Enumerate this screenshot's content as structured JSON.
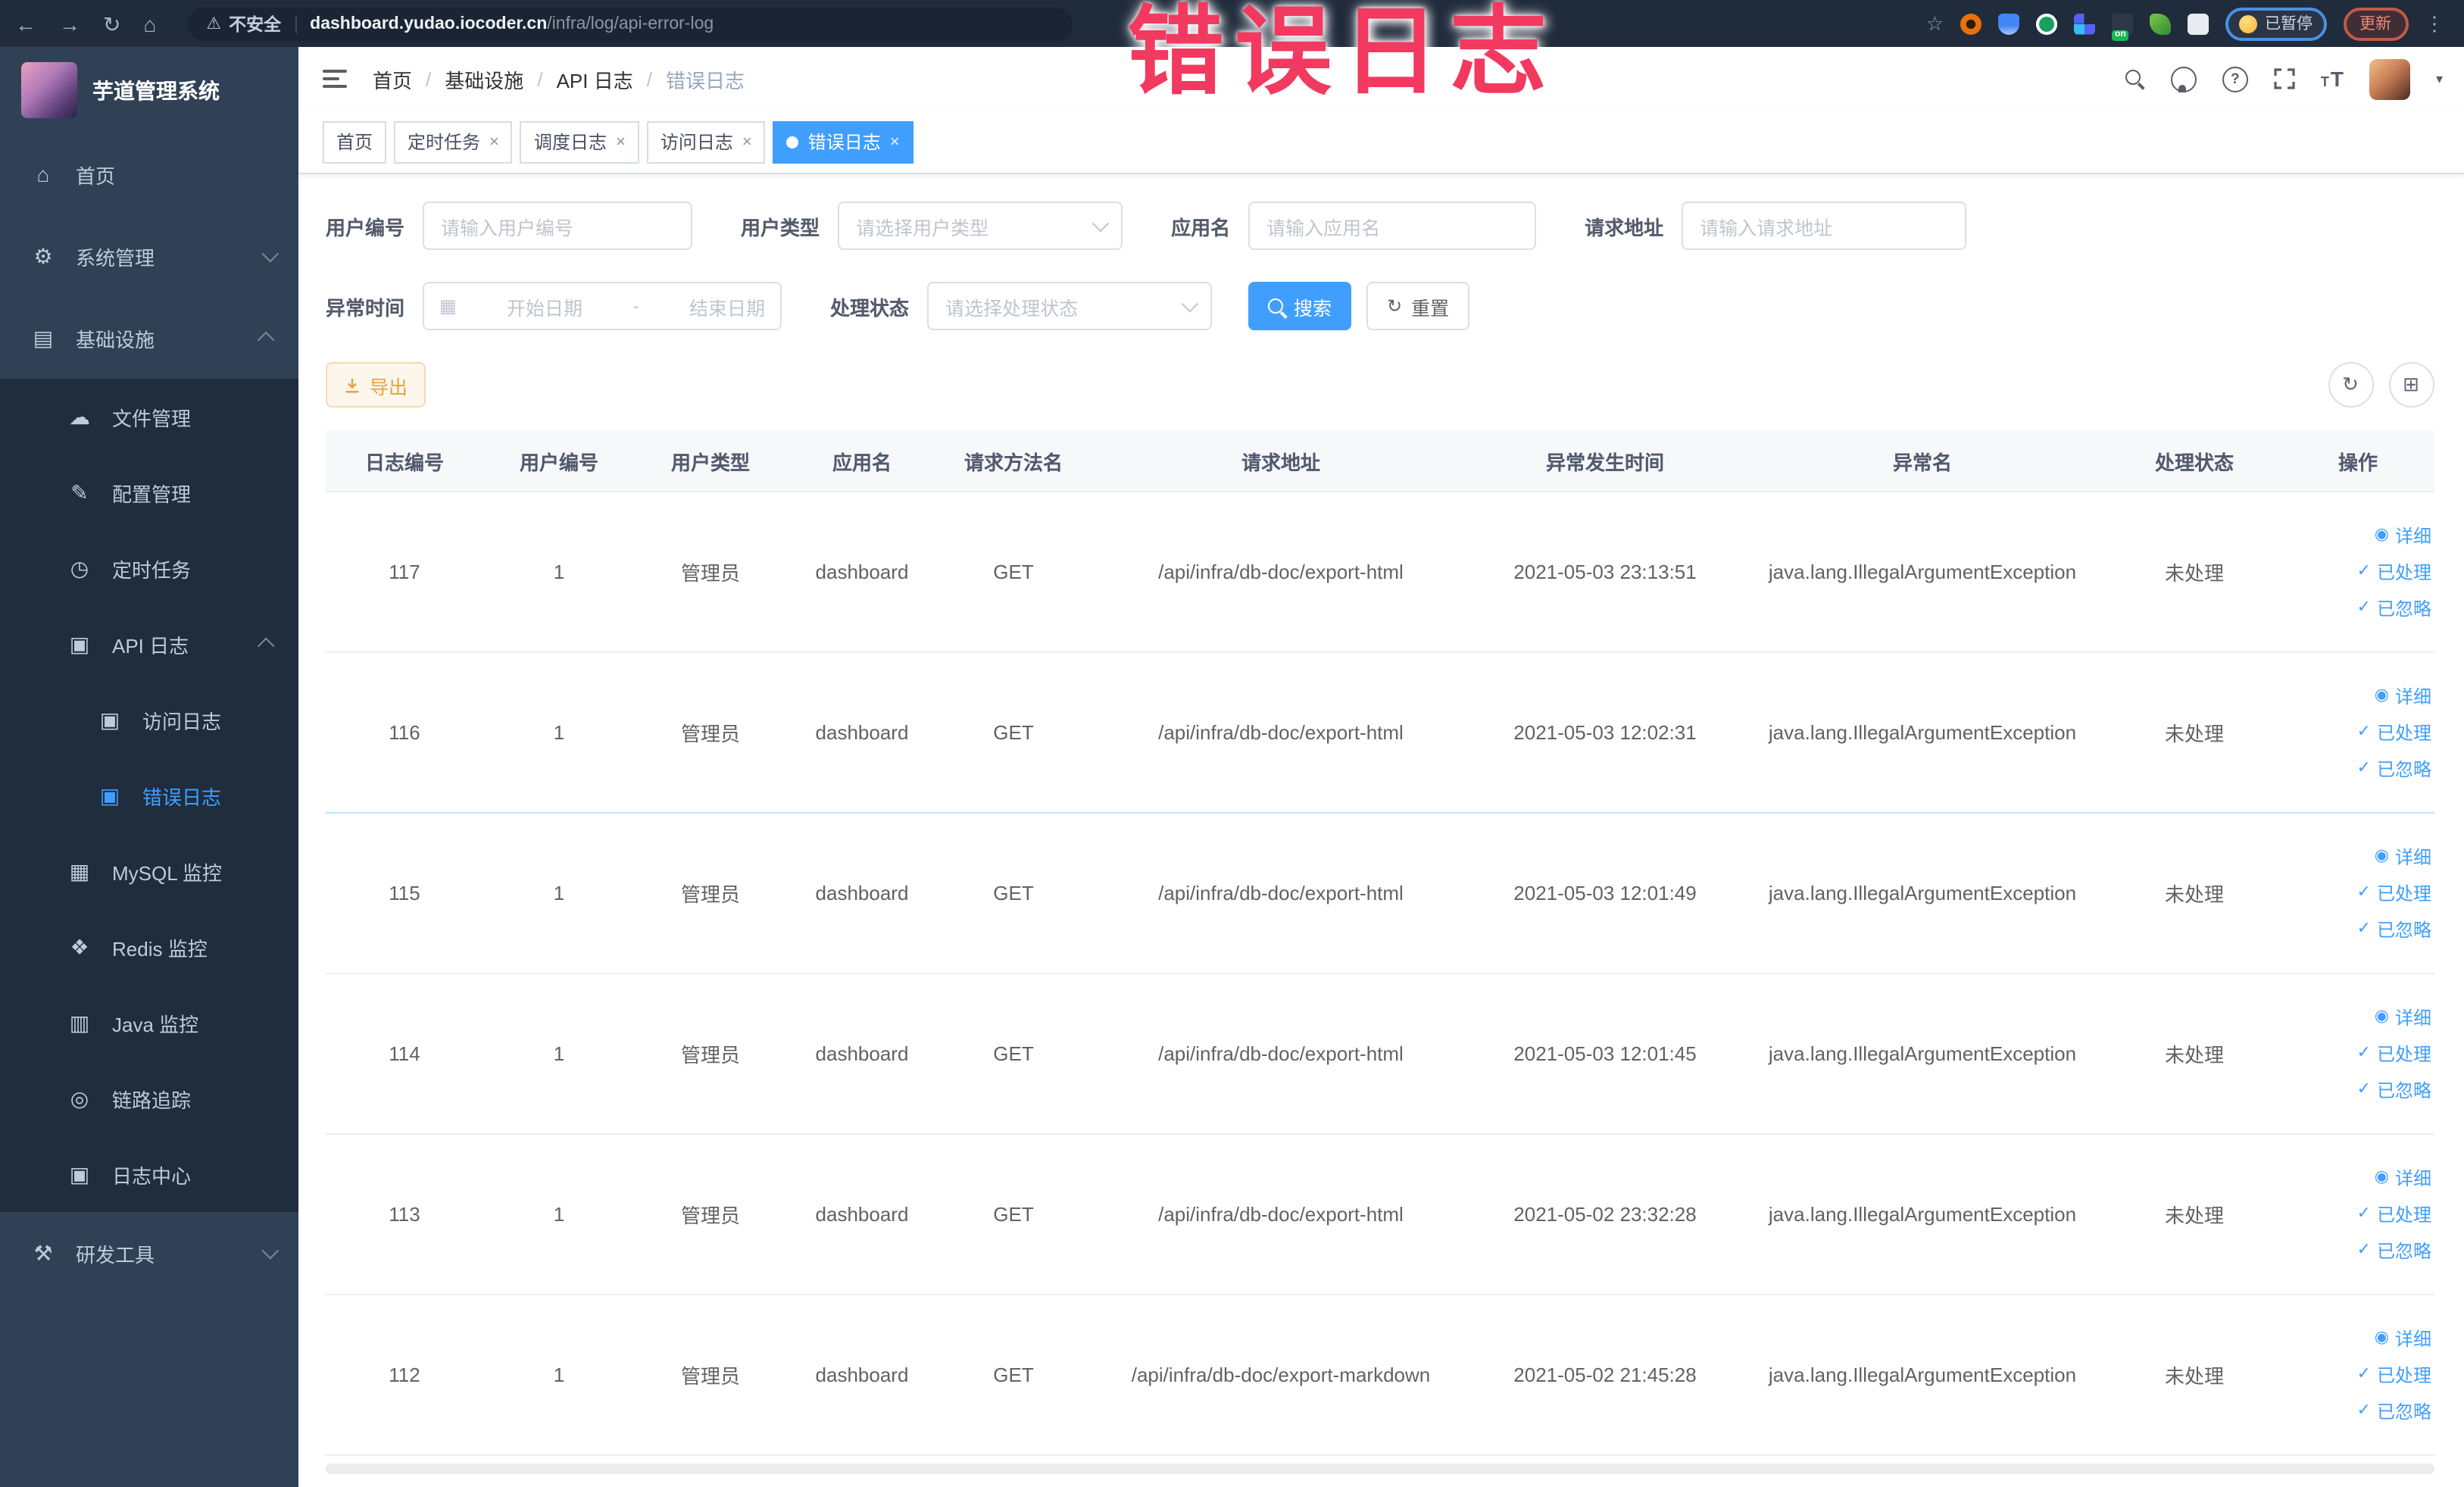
{
  "overlay": {
    "title": "错误日志"
  },
  "browser": {
    "security_label": "不安全",
    "url_domain": "dashboard.yudao.iocoder.cn",
    "url_path": "/infra/log/api-error-log",
    "paused_label": "已暂停",
    "update_label": "更新"
  },
  "sidebar": {
    "app_title": "芋道管理系统",
    "items": [
      {
        "label": "首页",
        "glyph": "⌂"
      },
      {
        "label": "系统管理",
        "glyph": "⚙"
      },
      {
        "label": "基础设施",
        "glyph": "▤"
      },
      {
        "label": "文件管理",
        "glyph": "☁"
      },
      {
        "label": "配置管理",
        "glyph": "✎"
      },
      {
        "label": "定时任务",
        "glyph": "◷"
      },
      {
        "label": "API 日志",
        "glyph": "▣"
      },
      {
        "label": "访问日志",
        "glyph": "▣"
      },
      {
        "label": "错误日志",
        "glyph": "▣"
      },
      {
        "label": "MySQL 监控",
        "glyph": "▦"
      },
      {
        "label": "Redis 监控",
        "glyph": "❖"
      },
      {
        "label": "Java 监控",
        "glyph": "▥"
      },
      {
        "label": "链路追踪",
        "glyph": "◎"
      },
      {
        "label": "日志中心",
        "glyph": "▣"
      },
      {
        "label": "研发工具",
        "glyph": "⚒"
      }
    ]
  },
  "breadcrumb": {
    "separator": "/",
    "items": [
      "首页",
      "基础设施",
      "API 日志",
      "错误日志"
    ]
  },
  "tabs": [
    {
      "label": "首页"
    },
    {
      "label": "定时任务"
    },
    {
      "label": "调度日志"
    },
    {
      "label": "访问日志"
    },
    {
      "label": "错误日志"
    }
  ],
  "filters": {
    "user_id_label": "用户编号",
    "user_id_placeholder": "请输入用户编号",
    "user_type_label": "用户类型",
    "user_type_placeholder": "请选择用户类型",
    "app_name_label": "应用名",
    "app_name_placeholder": "请输入应用名",
    "request_url_label": "请求地址",
    "request_url_placeholder": "请输入请求地址",
    "exception_time_label": "异常时间",
    "date_start_placeholder": "开始日期",
    "date_separator": "-",
    "date_end_placeholder": "结束日期",
    "process_status_label": "处理状态",
    "process_status_placeholder": "请选择处理状态",
    "search_label": "搜索",
    "reset_label": "重置"
  },
  "toolbar": {
    "export_label": "导出"
  },
  "table": {
    "headers": [
      "日志编号",
      "用户编号",
      "用户类型",
      "应用名",
      "请求方法名",
      "请求地址",
      "异常发生时间",
      "异常名",
      "处理状态",
      "操作"
    ],
    "actions": [
      "详细",
      "已处理",
      "已忽略"
    ],
    "rows": [
      {
        "id": "117",
        "user_id": "1",
        "user_type": "管理员",
        "app_name": "dashboard",
        "method": "GET",
        "url": "/api/infra/db-doc/export-html",
        "time": "2021-05-03 23:13:51",
        "exception": "java.lang.IllegalArgumentException",
        "status": "未处理"
      },
      {
        "id": "116",
        "user_id": "1",
        "user_type": "管理员",
        "app_name": "dashboard",
        "method": "GET",
        "url": "/api/infra/db-doc/export-html",
        "time": "2021-05-03 12:02:31",
        "exception": "java.lang.IllegalArgumentException",
        "status": "未处理"
      },
      {
        "id": "115",
        "user_id": "1",
        "user_type": "管理员",
        "app_name": "dashboard",
        "method": "GET",
        "url": "/api/infra/db-doc/export-html",
        "time": "2021-05-03 12:01:49",
        "exception": "java.lang.IllegalArgumentException",
        "status": "未处理"
      },
      {
        "id": "114",
        "user_id": "1",
        "user_type": "管理员",
        "app_name": "dashboard",
        "method": "GET",
        "url": "/api/infra/db-doc/export-html",
        "time": "2021-05-03 12:01:45",
        "exception": "java.lang.IllegalArgumentException",
        "status": "未处理"
      },
      {
        "id": "113",
        "user_id": "1",
        "user_type": "管理员",
        "app_name": "dashboard",
        "method": "GET",
        "url": "/api/infra/db-doc/export-html",
        "time": "2021-05-02 23:32:28",
        "exception": "java.lang.IllegalArgumentException",
        "status": "未处理"
      },
      {
        "id": "112",
        "user_id": "1",
        "user_type": "管理员",
        "app_name": "dashboard",
        "method": "GET",
        "url": "/api/infra/db-doc/export-markdown",
        "time": "2021-05-02 21:45:28",
        "exception": "java.lang.IllegalArgumentException",
        "status": "未处理"
      }
    ]
  },
  "icons": {
    "eye": "◉",
    "check": "✓",
    "refresh": "↻",
    "grid": "⊞",
    "star": "☆",
    "warning": "⚠",
    "back": "←",
    "forward": "→",
    "reload": "↻",
    "home": "⌂",
    "caret": "▾",
    "kebab": "⋮",
    "calendar": "▦"
  },
  "colors": {
    "accent": "#409eff",
    "warning_button": "#e6a23c",
    "overlay_pink": "#f2395f",
    "sidebar_bg": "#304156",
    "submenu_bg": "#1f2d3d",
    "browser_bar": "#202b3c"
  }
}
